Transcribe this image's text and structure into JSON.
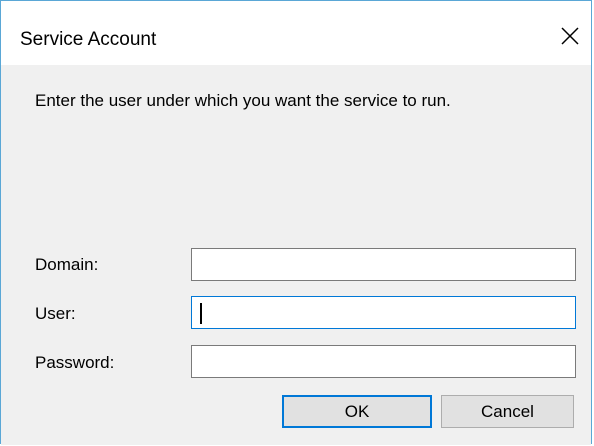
{
  "dialog": {
    "title": "Service Account",
    "close_icon": "close-icon",
    "instructions": "Enter the user under which you want the service to run."
  },
  "form": {
    "domain_label": "Domain:",
    "domain_value": "",
    "user_label": "User:",
    "user_value": "",
    "password_label": "Password:",
    "password_value": ""
  },
  "buttons": {
    "ok_label": "OK",
    "cancel_label": "Cancel"
  },
  "colors": {
    "accent": "#0078d7",
    "dialog_border": "#5aa7d6",
    "dialog_background": "#f0f0f0",
    "button_background": "#e1e1e1"
  }
}
